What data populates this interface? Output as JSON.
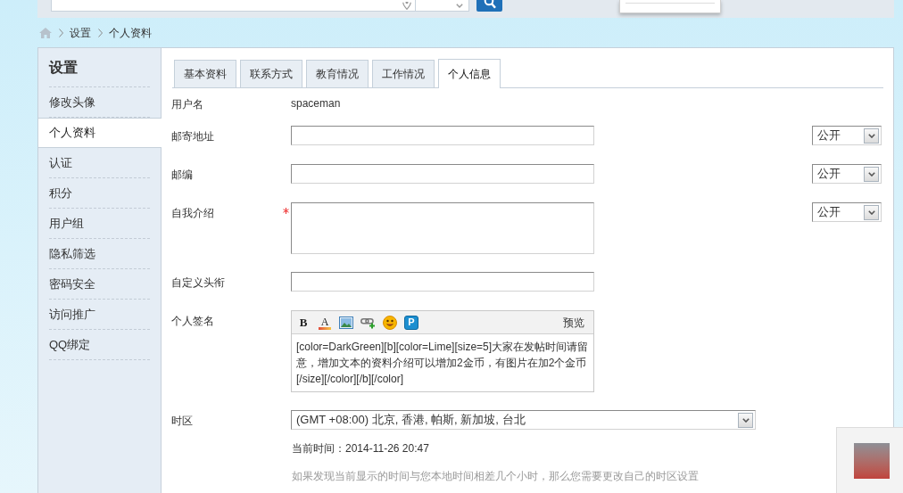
{
  "breadcrumb": [
    "设置",
    "个人资料"
  ],
  "sidebar": {
    "title": "设置",
    "items": [
      {
        "label": "修改头像",
        "selected": false
      },
      {
        "label": "个人资料",
        "selected": true
      },
      {
        "label": "认证",
        "selected": false
      },
      {
        "label": "积分",
        "selected": false
      },
      {
        "label": "用户组",
        "selected": false
      },
      {
        "label": "隐私筛选",
        "selected": false
      },
      {
        "label": "密码安全",
        "selected": false
      },
      {
        "label": "访问推广",
        "selected": false
      },
      {
        "label": "QQ绑定",
        "selected": false
      }
    ]
  },
  "tabs": [
    {
      "label": "基本资料",
      "selected": false
    },
    {
      "label": "联系方式",
      "selected": false
    },
    {
      "label": "教育情况",
      "selected": false
    },
    {
      "label": "工作情况",
      "selected": false
    },
    {
      "label": "个人信息",
      "selected": true
    }
  ],
  "form": {
    "rows": [
      {
        "kind": "text",
        "label": "用户名",
        "value": "spaceman",
        "required": false
      },
      {
        "kind": "input",
        "label": "邮寄地址",
        "required": false,
        "privacy": "公开"
      },
      {
        "kind": "input",
        "label": "邮编",
        "required": false,
        "privacy": "公开"
      },
      {
        "kind": "textarea",
        "label": "自我介绍",
        "required": true,
        "privacy": "公开"
      },
      {
        "kind": "input",
        "label": "自定义头衔",
        "required": false
      },
      {
        "kind": "editor",
        "label": "个人签名",
        "required": false,
        "toolbar": [
          {
            "kind": "bold",
            "label": "B"
          },
          {
            "kind": "font_color",
            "label": "A"
          },
          {
            "kind": "image"
          },
          {
            "kind": "link"
          },
          {
            "kind": "emoji"
          },
          {
            "kind": "badge",
            "label": "P"
          }
        ],
        "preview": "预览",
        "value": "[color=DarkGreen][b][color=Lime][size=5]大家在发帖时间请留意，增加文本的资料介绍可以增加2金币，有图片在加2个金币[/size][/color][/b][/color]"
      },
      {
        "kind": "select",
        "label": "时区",
        "required": false,
        "value": "(GMT +08:00) 北京, 香港, 帕斯, 新加坡, 台北",
        "current_time": "当前时间：2014-11-26 20:47",
        "hint": "如果发现当前显示的时间与您本地时间相差几个小时，那么您需要更改自己的时区设置"
      }
    ]
  }
}
